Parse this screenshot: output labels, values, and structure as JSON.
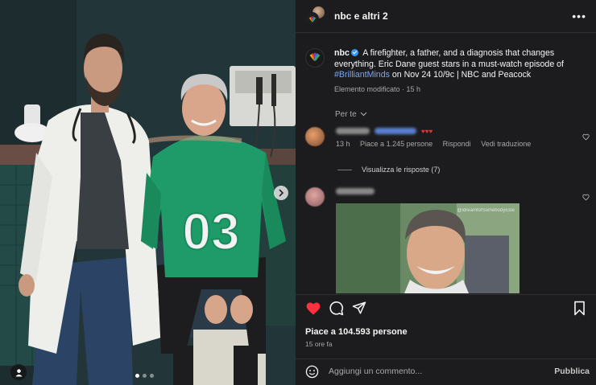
{
  "header": {
    "title": "nbc e altri 2",
    "more_icon": "more-horizontal-icon"
  },
  "caption": {
    "username": "nbc",
    "text": "A firefighter, a father, and a diagnosis that changes everything. Eric Dane guest stars in a must-watch episode of",
    "hashtag": "#BrilliantMinds",
    "text_after": "on Nov 24 10/9c | NBC and Peacock",
    "edited": "Elemento modificato",
    "time": "15 h"
  },
  "per_te": "Per te",
  "comments": [
    {
      "time": "13 h",
      "likes": "Piace a 1.245 persone",
      "reply": "Rispondi",
      "translate": "Vedi traduzione"
    }
  ],
  "view_replies": "Visualizza le risposte (7)",
  "gif_watermark": "@idreamtofSomebodyElse",
  "actions": {
    "like_icon": "heart-filled-icon",
    "comment_icon": "comment-icon",
    "share_icon": "send-icon",
    "save_icon": "bookmark-icon"
  },
  "post_likes": "Piace a 104.593 persone",
  "post_time": "15 ore fa",
  "add_comment": {
    "placeholder": "Aggiungi un commento...",
    "publish": "Pubblica"
  },
  "media": {
    "jersey_number": "03",
    "carousel_count": 3,
    "carousel_active": 1
  },
  "colors": {
    "like_red": "#ff3040",
    "link_blue": "#7aa8f5",
    "verified_blue": "#3897f0"
  }
}
